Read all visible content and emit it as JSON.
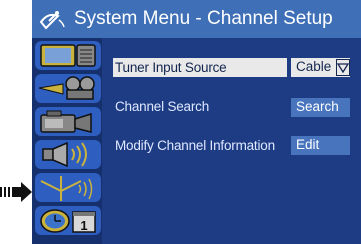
{
  "header": {
    "title": "System Menu - Channel Setup",
    "icon": "satellite-dish-icon"
  },
  "sidebar": {
    "items": [
      {
        "name": "tv-screen-icon"
      },
      {
        "name": "film-projector-icon"
      },
      {
        "name": "video-camera-icon"
      },
      {
        "name": "speaker-icon"
      },
      {
        "name": "antenna-icon",
        "active": true
      },
      {
        "name": "clock-calendar-icon"
      }
    ]
  },
  "pointer": {
    "icon": "pointer-arrow-icon"
  },
  "menu": {
    "rows": [
      {
        "label": "Tuner Input Source",
        "value": "Cable",
        "has_dropdown": true,
        "selected": true
      },
      {
        "label": "Channel Search",
        "value": "Search",
        "has_dropdown": false,
        "selected": false
      },
      {
        "label": "Modify Channel Information",
        "value": "Edit",
        "has_dropdown": false,
        "selected": false
      }
    ]
  },
  "calendar_number": "1",
  "colors": {
    "background": "#1d3c84",
    "header": "#3f6fb6",
    "highlight": "#e9e9e9",
    "button": "#4774bd",
    "sidebar_icon_bg": "#2d5ec0"
  }
}
